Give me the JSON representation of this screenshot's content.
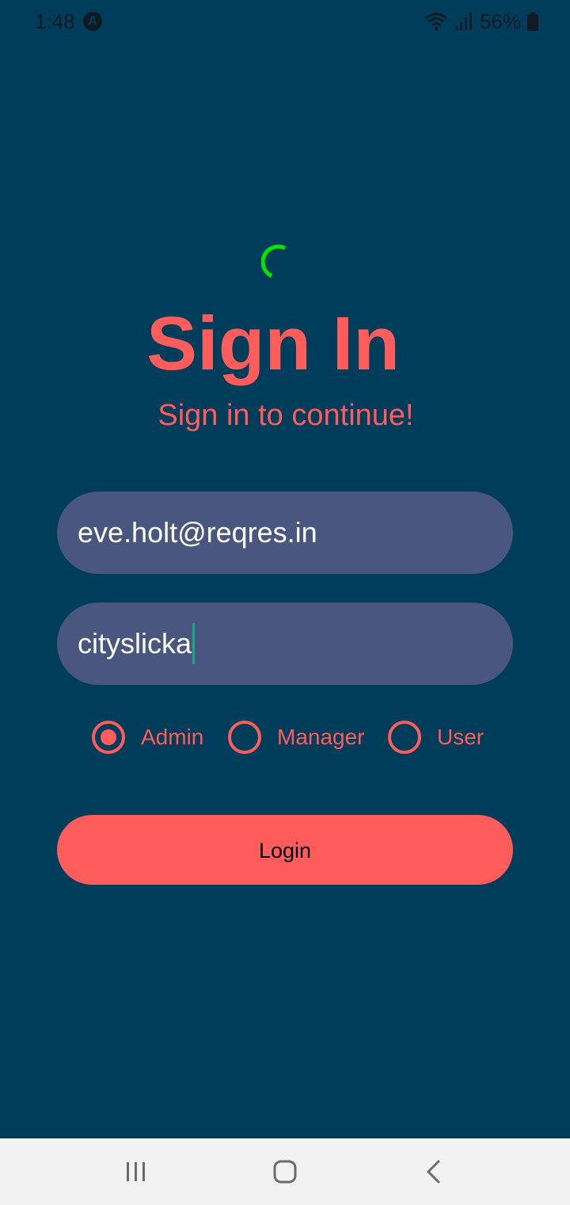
{
  "status_bar": {
    "time": "1:48",
    "app_badge": "A",
    "battery_percent": "56%"
  },
  "login": {
    "title": "Sign In",
    "subtitle": "Sign in to continue!",
    "email_value": "eve.holt@reqres.in",
    "password_value": "cityslicka",
    "roles": [
      {
        "label": "Admin",
        "selected": true
      },
      {
        "label": "Manager",
        "selected": false
      },
      {
        "label": "User",
        "selected": false
      }
    ],
    "login_label": "Login"
  },
  "colors": {
    "background": "#003d5b",
    "accent": "#ff5c5c",
    "field": "#495780",
    "spinner": "#00e600"
  },
  "icons": {
    "spinner": "loading-spinner-icon",
    "wifi": "wifi-icon",
    "signal": "signal-icon",
    "battery": "battery-icon",
    "nav_recents": "recents-icon",
    "nav_home": "home-icon",
    "nav_back": "back-icon"
  }
}
